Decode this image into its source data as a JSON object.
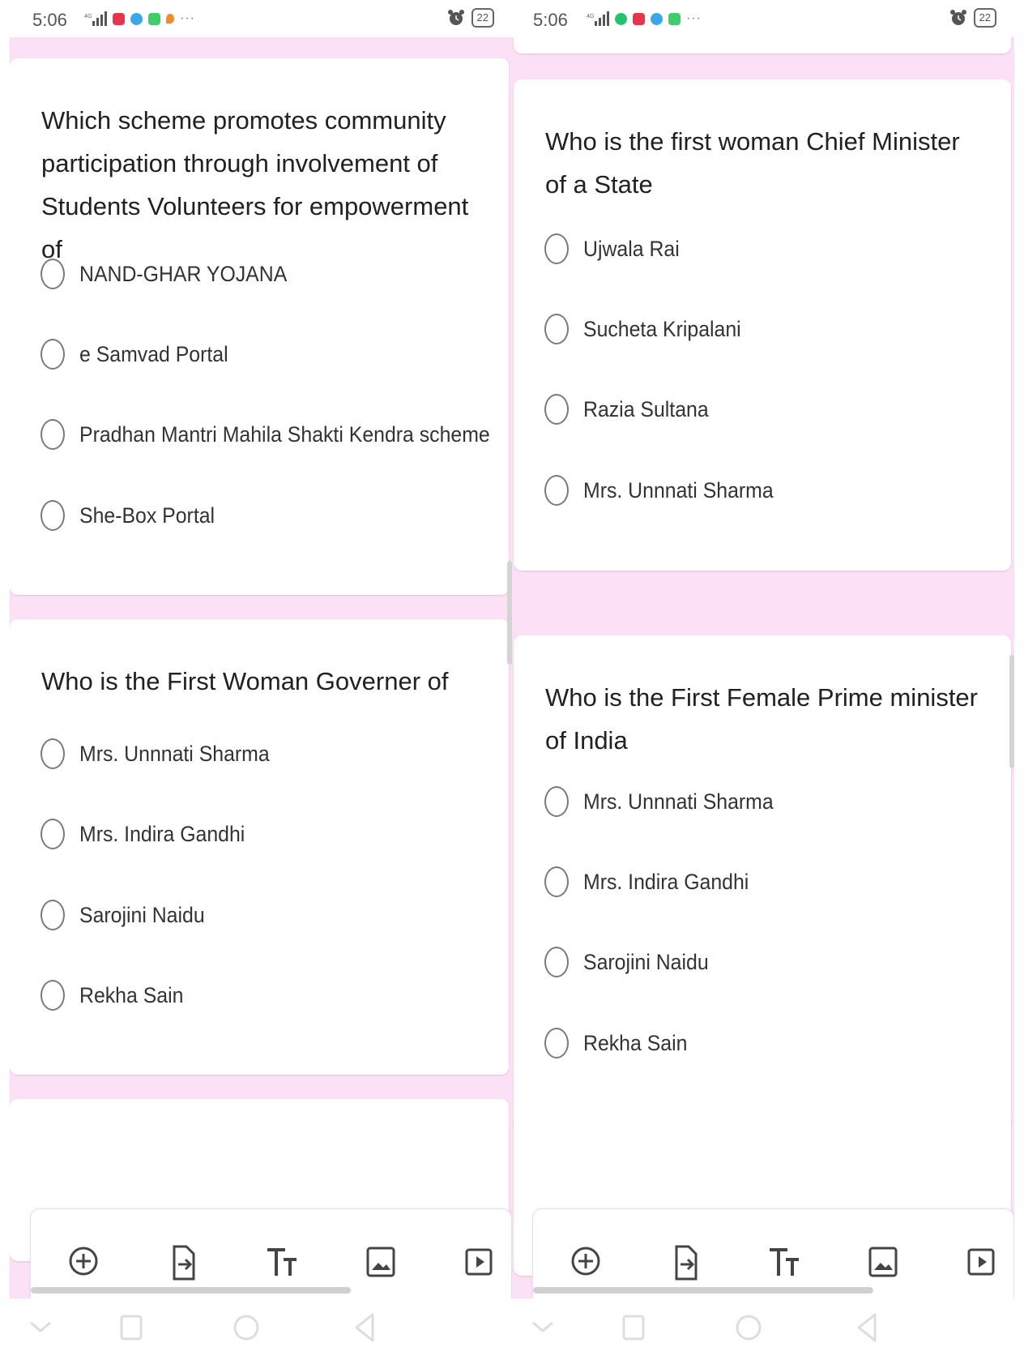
{
  "left": {
    "status": {
      "time": "5:06",
      "battery": "22"
    },
    "cards": [
      {
        "question": "Which scheme promotes community participation through involvement of Students Volunteers for empowerment of",
        "options": [
          "NAND-GHAR YOJANA",
          "e Samvad Portal",
          "Pradhan Mantri Mahila Shakti Kendra scheme",
          "She-Box Portal"
        ]
      },
      {
        "question": "Who is the First Woman Governer of",
        "options": [
          "Mrs. Unnnati Sharma",
          "Mrs. Indira Gandhi",
          "Sarojini Naidu",
          "Rekha Sain"
        ]
      }
    ]
  },
  "right": {
    "status": {
      "time": "5:06",
      "battery": "22"
    },
    "cards": [
      {
        "question": "Who is the first woman Chief Minister of a State",
        "options": [
          "Ujwala Rai",
          "Sucheta Kripalani",
          "Razia Sultana",
          "Mrs. Unnnati Sharma"
        ]
      },
      {
        "question": "Who is the First Female Prime minister of India",
        "options": [
          "Mrs. Unnnati Sharma",
          "Mrs. Indira Gandhi",
          "Sarojini Naidu",
          "Rekha Sain"
        ]
      }
    ]
  },
  "toolbar_icons": [
    "add-question-icon",
    "import-questions-icon",
    "add-title-icon",
    "add-image-icon",
    "add-video-icon"
  ],
  "nav_icons": [
    "hide-nav-icon",
    "recents-icon",
    "home-icon",
    "back-icon"
  ],
  "colors": {
    "page_background": "#fbe0f6",
    "card": "#ffffff",
    "radio_border": "#7a7a7a"
  }
}
